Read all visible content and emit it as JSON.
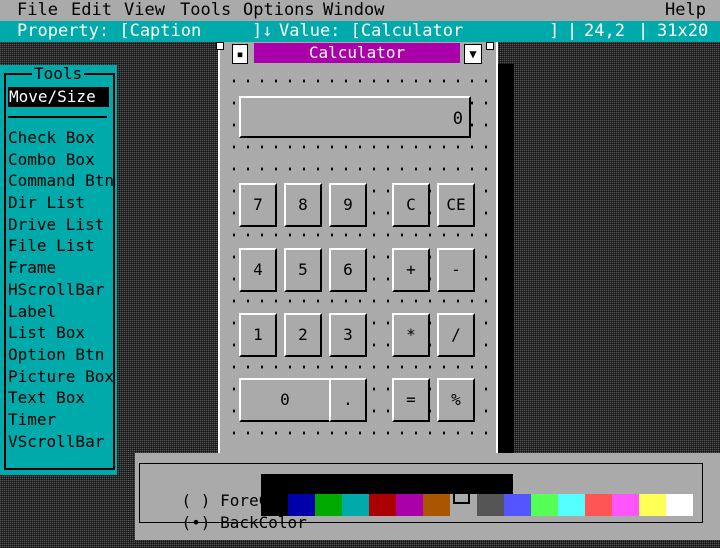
{
  "menu": {
    "file": "File",
    "edit": "Edit",
    "view": "View",
    "tools": "Tools",
    "options": "Options",
    "window": "Window",
    "help": "Help"
  },
  "property_bar": {
    "property_label": "Property: [Caption",
    "value_arrow": "]↓",
    "value_label": "Value: [Calculator",
    "value_end": "]",
    "position": "24,2",
    "size": "31x20"
  },
  "toolbox": {
    "title": "Tools",
    "selected": "Move/Size",
    "items": [
      "Check Box",
      "Combo Box",
      "Command Btn",
      "Dir List",
      "Drive List",
      "File List",
      "Frame",
      "HScrollBar",
      "Label",
      "List Box",
      "Option Btn",
      "Picture Box",
      "Text Box",
      "Timer",
      "VScrollBar"
    ]
  },
  "form": {
    "sys_icon": "▪",
    "caption": "Calculator",
    "dropdown_icon": "▼",
    "display_value": "0",
    "buttons": {
      "b7": "7",
      "b8": "8",
      "b9": "9",
      "bC": "C",
      "bCE": "CE",
      "b4": "4",
      "b5": "5",
      "b6": "6",
      "plus": "+",
      "minus": "-",
      "b1": "1",
      "b2": "2",
      "b3": "3",
      "mult": "*",
      "div": "/",
      "b0": "0",
      "dot": ".",
      "eq": "=",
      "pct": "%"
    }
  },
  "palette": {
    "fore_radio": "( )",
    "fore_label": "ForeColor",
    "back_radio": "(•)",
    "back_label": "BackColor",
    "colors": [
      "#000000",
      "#0000aa",
      "#00aa00",
      "#00aaaa",
      "#aa0000",
      "#aa00aa",
      "#aa5500",
      "#aaaaaa",
      "#555555",
      "#5555ff",
      "#55ff55",
      "#55ffff",
      "#ff5555",
      "#ff55ff",
      "#ffff55",
      "#ffffff"
    ],
    "selected_index": 7
  }
}
